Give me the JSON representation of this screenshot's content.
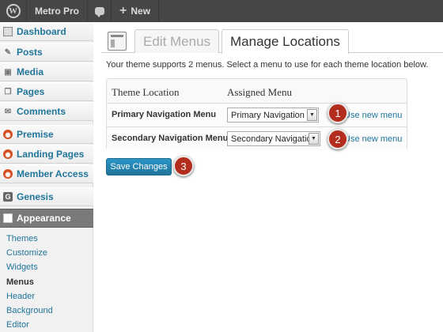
{
  "adminbar": {
    "site_name": "Metro Pro",
    "new_label": "New",
    "wp_icon": "wordpress-logo-icon",
    "comment_icon": "comment-bubble-icon"
  },
  "sidebar": {
    "items": [
      {
        "label": "Dashboard",
        "icon": "dashboard-icon"
      },
      {
        "label": "Posts",
        "icon": "pushpin-icon"
      },
      {
        "label": "Media",
        "icon": "media-icon"
      },
      {
        "label": "Pages",
        "icon": "pages-icon"
      },
      {
        "label": "Comments",
        "icon": "comments-icon"
      },
      {
        "label": "Premise",
        "icon": "premise-icon"
      },
      {
        "label": "Landing Pages",
        "icon": "landing-pages-icon"
      },
      {
        "label": "Member Access",
        "icon": "member-access-icon"
      },
      {
        "label": "Genesis",
        "icon": "genesis-icon"
      },
      {
        "label": "Appearance",
        "icon": "appearance-icon"
      }
    ],
    "submenu": [
      "Themes",
      "Customize",
      "Widgets",
      "Menus",
      "Header",
      "Background",
      "Editor"
    ],
    "current_submenu": "Menus"
  },
  "main": {
    "tabs": [
      {
        "label": "Edit Menus"
      },
      {
        "label": "Manage Locations"
      }
    ],
    "active_tab": "Manage Locations",
    "intro": "Your theme supports 2 menus. Select a menu to use for each theme location below.",
    "table": {
      "headers": [
        "Theme Location",
        "Assigned Menu"
      ],
      "rows": [
        {
          "location": "Primary Navigation Menu",
          "menu": "Primary Navigation",
          "link": "Use new menu"
        },
        {
          "location": "Secondary Navigation Menu",
          "menu": "Secondary Navigation",
          "link": "Use new menu"
        }
      ]
    },
    "save_label": "Save Changes"
  },
  "callouts": [
    "1",
    "2",
    "3"
  ],
  "colors": {
    "adminbar": "#464646",
    "link": "#21759b",
    "active_menu": "#7a7a7a",
    "button": "#21759b",
    "callout": "#b32d1f"
  }
}
